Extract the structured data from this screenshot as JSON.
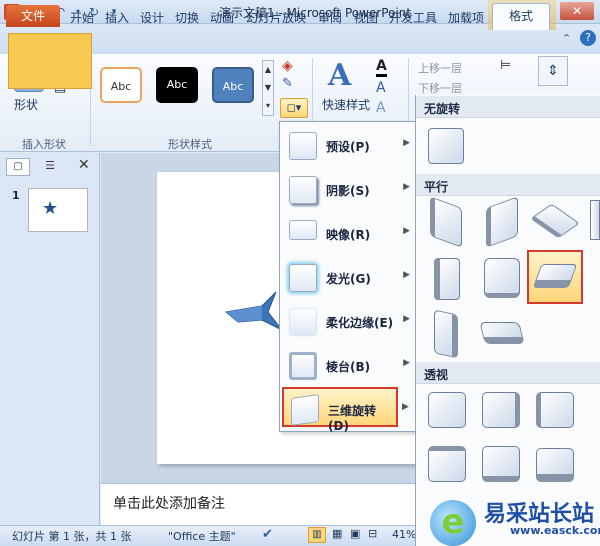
{
  "app": {
    "icon_letter": "P",
    "title": "演示文稿1 - Microsoft PowerPoint"
  },
  "window": {
    "minimize": "—",
    "maximize": "□",
    "close": "✕"
  },
  "tabs": {
    "file": "文件",
    "items": [
      "开始",
      "插入",
      "设计",
      "切换",
      "动画",
      "幻灯片放映",
      "审阅",
      "视图",
      "开发工具",
      "加载项"
    ],
    "active": "格式"
  },
  "ribbon": {
    "shape_button": "形状",
    "insert_shape_group": "插入形状",
    "shape_styles_group": "形状样式",
    "style_samples": [
      "Abc",
      "Abc",
      "Abc"
    ],
    "quick_styles": "快速样式",
    "bring_forward": "上移一层",
    "send_backward": "下移一层"
  },
  "leftpanel": {
    "slide_number": "1"
  },
  "notes": {
    "placeholder": "单击此处添加备注"
  },
  "statusbar": {
    "slide_info": "幻灯片 第 1 张，共 1 张",
    "theme": "\"Office 主题\"",
    "zoom": "41%"
  },
  "menu": {
    "items": [
      {
        "label": "预设(P)"
      },
      {
        "label": "阴影(S)"
      },
      {
        "label": "映像(R)"
      },
      {
        "label": "发光(G)"
      },
      {
        "label": "柔化边缘(E)"
      },
      {
        "label": "棱台(B)"
      },
      {
        "label": "三维旋转(D)"
      }
    ]
  },
  "gallery": {
    "no_rotation": "无旋转",
    "parallel": "平行",
    "perspective": "透视"
  },
  "watermark": {
    "text": "易采站长站",
    "url": "www.easck.com",
    "logo_letter": "e"
  },
  "colors": {
    "accent": "#d24726",
    "selected": "#ffd67a",
    "highlight_border": "#d63a2e"
  }
}
